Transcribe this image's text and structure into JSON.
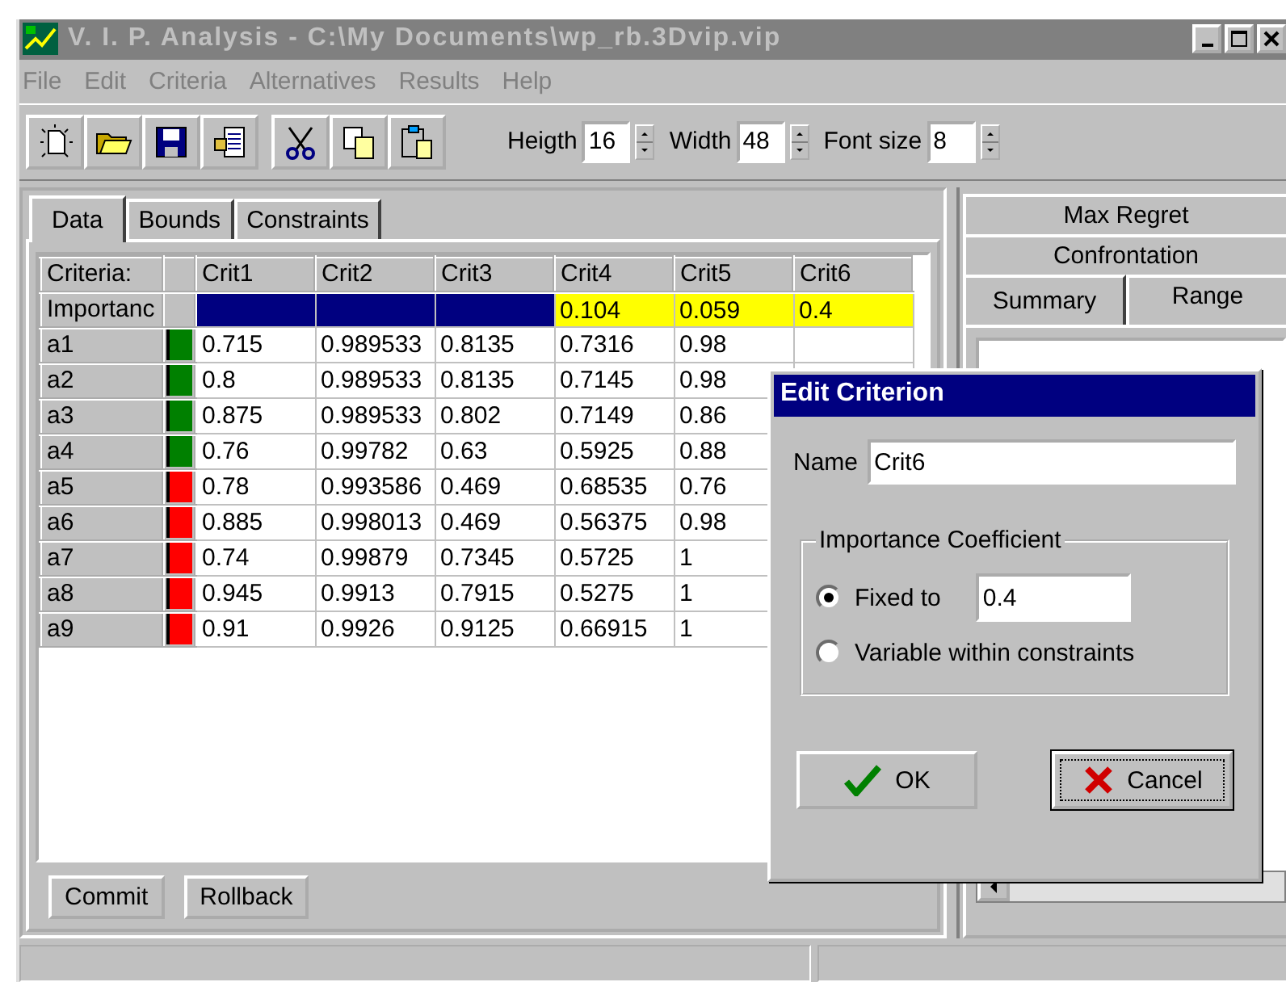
{
  "window": {
    "title": "V. I. P.  Analysis - C:\\My Documents\\wp_rb.3Dvip.vip"
  },
  "menu": [
    "File",
    "Edit",
    "Criteria",
    "Alternatives",
    "Results",
    "Help"
  ],
  "spinners": [
    {
      "label": "Heigth",
      "value": "16"
    },
    {
      "label": "Width",
      "value": "48"
    },
    {
      "label": "Font size",
      "value": "8"
    }
  ],
  "tabs": [
    {
      "label": "Data",
      "selected": true
    },
    {
      "label": "Bounds",
      "selected": false
    },
    {
      "label": "Constraints",
      "selected": false
    }
  ],
  "grid": {
    "corner": "Criteria:",
    "columns": [
      "Crit1",
      "Crit2",
      "Crit3",
      "Crit4",
      "Crit5",
      "Crit6"
    ],
    "importance": {
      "label": "Importanc",
      "cells": [
        {
          "fixed": false
        },
        {
          "fixed": false
        },
        {
          "fixed": false
        },
        {
          "fixed": true,
          "value": "0.104"
        },
        {
          "fixed": true,
          "value": "0.059"
        },
        {
          "fixed": true,
          "value": "0.4"
        }
      ]
    },
    "rows": [
      {
        "name": "a1",
        "color": "#008000",
        "values": [
          "0.715",
          "0.989533",
          "0.8135",
          "0.7316",
          "0.98"
        ]
      },
      {
        "name": "a2",
        "color": "#008000",
        "values": [
          "0.8",
          "0.989533",
          "0.8135",
          "0.7145",
          "0.98"
        ]
      },
      {
        "name": "a3",
        "color": "#008000",
        "values": [
          "0.875",
          "0.989533",
          "0.802",
          "0.7149",
          "0.86"
        ]
      },
      {
        "name": "a4",
        "color": "#008000",
        "values": [
          "0.76",
          "0.99782",
          "0.63",
          "0.5925",
          "0.88"
        ]
      },
      {
        "name": "a5",
        "color": "#ff0000",
        "values": [
          "0.78",
          "0.993586",
          "0.469",
          "0.68535",
          "0.76"
        ]
      },
      {
        "name": "a6",
        "color": "#ff0000",
        "values": [
          "0.885",
          "0.998013",
          "0.469",
          "0.56375",
          "0.98"
        ]
      },
      {
        "name": "a7",
        "color": "#ff0000",
        "values": [
          "0.74",
          "0.99879",
          "0.7345",
          "0.5725",
          "1"
        ]
      },
      {
        "name": "a8",
        "color": "#ff0000",
        "values": [
          "0.945",
          "0.9913",
          "0.7915",
          "0.5275",
          "1"
        ]
      },
      {
        "name": "a9",
        "color": "#ff0000",
        "values": [
          "0.91",
          "0.9926",
          "0.9125",
          "0.66915",
          "1"
        ]
      }
    ]
  },
  "actions": [
    "Commit",
    "Rollback"
  ],
  "result_tabs": [
    {
      "label": "Max Regret",
      "selected": false
    },
    {
      "label": "Confrontation",
      "selected": false
    },
    {
      "label": "Summary",
      "selected": true
    },
    {
      "label": "Range",
      "selected": false
    }
  ],
  "dialog": {
    "title": "Edit Criterion",
    "name_label": "Name",
    "name_value": "Crit6",
    "group": "Importance Coefficient",
    "options": [
      {
        "label": "Fixed to",
        "selected": true,
        "value": "0.4"
      },
      {
        "label": "Variable within constraints",
        "selected": false
      }
    ],
    "ok": "OK",
    "cancel": "Cancel"
  }
}
